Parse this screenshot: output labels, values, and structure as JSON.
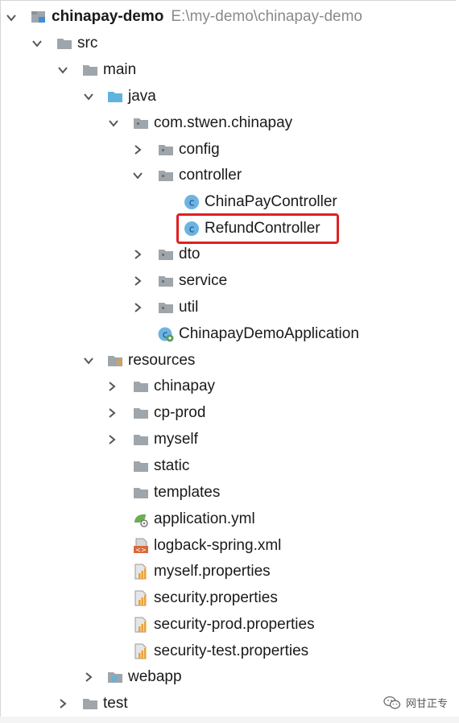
{
  "project_tree": {
    "root": {
      "label": "chinapay-demo",
      "path": "E:\\my-demo\\chinapay-demo"
    },
    "items": [
      {
        "label": "src"
      },
      {
        "label": "main"
      },
      {
        "label": "java"
      },
      {
        "label": "com.stwen.chinapay"
      },
      {
        "label": "config"
      },
      {
        "label": "controller"
      },
      {
        "label": "ChinaPayController"
      },
      {
        "label": "RefundController"
      },
      {
        "label": "dto"
      },
      {
        "label": "service"
      },
      {
        "label": "util"
      },
      {
        "label": "ChinapayDemoApplication"
      },
      {
        "label": "resources"
      },
      {
        "label": "chinapay"
      },
      {
        "label": "cp-prod"
      },
      {
        "label": "myself"
      },
      {
        "label": "static"
      },
      {
        "label": "templates"
      },
      {
        "label": "application.yml"
      },
      {
        "label": "logback-spring.xml"
      },
      {
        "label": "myself.properties"
      },
      {
        "label": "security.properties"
      },
      {
        "label": "security-prod.properties"
      },
      {
        "label": "security-test.properties"
      },
      {
        "label": "webapp"
      },
      {
        "label": "test"
      }
    ],
    "selected": "RefundController"
  },
  "watermark": {
    "text": "网甘正专"
  },
  "colors": {
    "highlight_border": "#e02020",
    "folder_gray": "#9ea5ab",
    "folder_blue": "#5fb3dd",
    "class_icon": "#6db3e3",
    "properties_bars": "#f0a030"
  }
}
